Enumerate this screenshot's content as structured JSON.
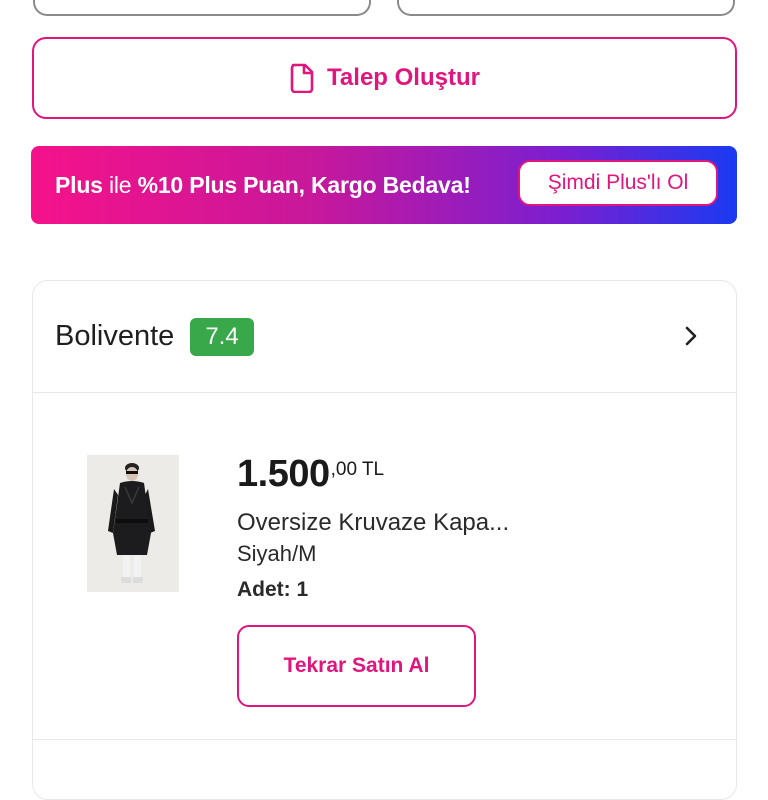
{
  "actions": {
    "request_label": "Talep Oluştur"
  },
  "plus_banner": {
    "text_plus": "Plus",
    "text_ile": " ile ",
    "text_offer": "%10 Plus Puan, Kargo Bedava!",
    "cta_label": "Şimdi Plus'lı Ol"
  },
  "seller": {
    "name": "Bolivente",
    "score": "7.4",
    "score_color": "#38a84a"
  },
  "product": {
    "price_main": "1.500",
    "price_frac": ",00 TL",
    "name": "Oversize Kruvaze Kapa...",
    "variant": "Siyah/M",
    "quantity": "Adet: 1",
    "rebuy_label": "Tekrar Satın Al"
  },
  "colors": {
    "accent": "#e0157e",
    "banner_start": "#f5128a",
    "banner_end": "#1a3af2"
  }
}
